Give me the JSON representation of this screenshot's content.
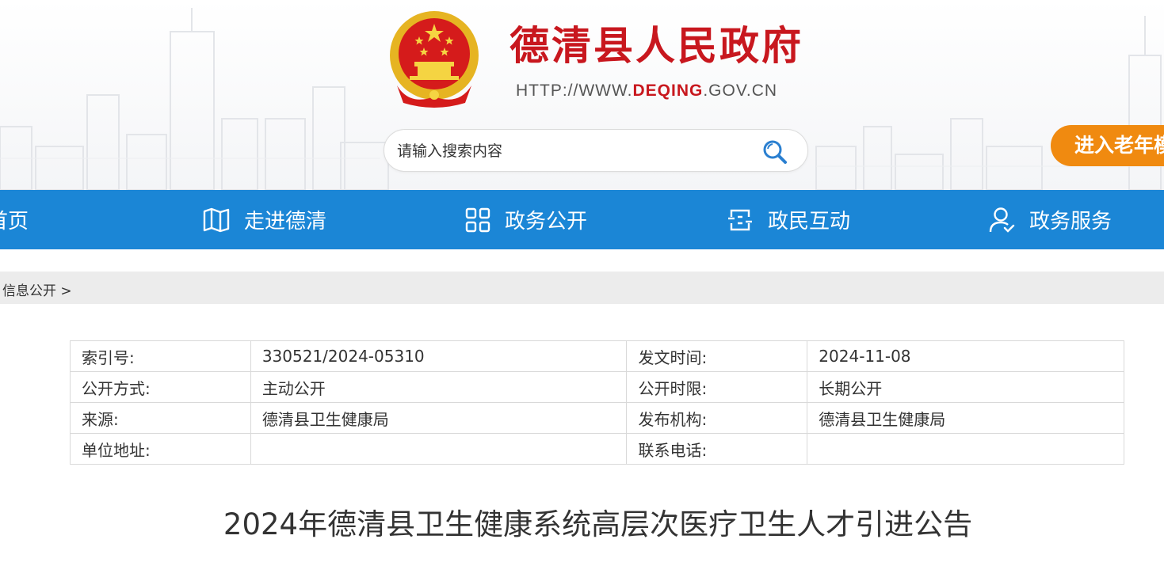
{
  "header": {
    "title": "德清县人民政府",
    "url_prefix": "HTTP://WWW.",
    "url_highlight": "DEQING",
    "url_suffix": ".GOV.CN",
    "search_placeholder": "请输入搜索内容",
    "elder_mode_label": "进入老年模式"
  },
  "nav": {
    "items": [
      {
        "label": "首页",
        "icon": "home-icon"
      },
      {
        "label": "走进德清",
        "icon": "map-icon"
      },
      {
        "label": "政务公开",
        "icon": "grid-icon"
      },
      {
        "label": "政民互动",
        "icon": "exchange-icon"
      },
      {
        "label": "政务服务",
        "icon": "user-icon"
      }
    ]
  },
  "breadcrumb": {
    "text": "信息公开 >"
  },
  "info": {
    "rows": [
      {
        "l1": "索引号:",
        "v1": "330521/2024-05310",
        "l2": "发文时间:",
        "v2": "2024-11-08"
      },
      {
        "l1": "公开方式:",
        "v1": "主动公开",
        "l2": "公开时限:",
        "v2": "长期公开"
      },
      {
        "l1": "来源:",
        "v1": "德清县卫生健康局",
        "l2": "发布机构:",
        "v2": "德清县卫生健康局"
      },
      {
        "l1": "单位地址:",
        "v1": "",
        "l2": "联系电话:",
        "v2": ""
      }
    ]
  },
  "article": {
    "title": "2024年德清县卫生健康系统高层次医疗卫生人才引进公告"
  },
  "colors": {
    "brand_red": "#c8171e",
    "nav_blue": "#1b86d6",
    "elder_orange": "#f08a10"
  }
}
